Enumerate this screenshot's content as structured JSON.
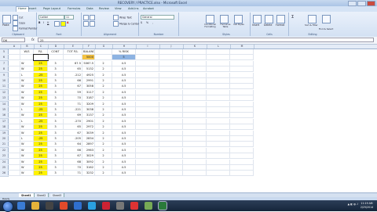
{
  "window": {
    "title": "RECOVERY / PRACTICE.xlsx - Microsoft Excel"
  },
  "ribbon_tabs": [
    "Home",
    "Insert",
    "Page Layout",
    "Formulas",
    "Data",
    "Review",
    "View",
    "Add-Ins",
    "Acrobat"
  ],
  "ribbon": {
    "clipboard": {
      "label": "Clipboard",
      "paste": "Paste",
      "cut": "Cut",
      "copy": "Copy",
      "format_painter": "Format Painter"
    },
    "font": {
      "label": "Font",
      "font_name": "Calibri",
      "font_size": "11"
    },
    "alignment": {
      "label": "Alignment",
      "wrap_text": "Wrap Text",
      "merge": "Merge & Center"
    },
    "number": {
      "label": "Number",
      "format": "General"
    },
    "styles": {
      "label": "Styles",
      "conditional": "Conditional Formatting",
      "format_table": "Format as Table",
      "cell_styles": "Cell Styles"
    },
    "cells": {
      "label": "Cells",
      "insert": "Insert",
      "delete": "Delete",
      "format": "Format"
    },
    "editing": {
      "label": "Editing",
      "sort": "Sort & Filter",
      "find": "Find & Select"
    }
  },
  "formula_bar": {
    "name_box": "D6",
    "fx": "fx",
    "value": "25"
  },
  "columns": [
    "A",
    "B",
    "C",
    "D",
    "E",
    "F",
    "G",
    "H",
    "I",
    "J",
    "K",
    "L",
    "M"
  ],
  "header_row": {
    "row_num": "5",
    "cells": [
      "",
      "W/S",
      "P/L",
      "CONT",
      "TOT P/L",
      "BALANCE",
      "",
      "% RISK"
    ]
  },
  "rows": [
    {
      "n": "6",
      "ws": "",
      "pl": "",
      "cont": "",
      "tot": "",
      "bal": "5000",
      "r": "",
      "risk": "5"
    },
    {
      "n": "7",
      "ws": "W",
      "pl": "25",
      "cont": "3",
      "tot": "67.5",
      "bal": "5067.5",
      "r": "2",
      "risk": "4.5"
    },
    {
      "n": "8",
      "ws": "W",
      "pl": "25",
      "cont": "3",
      "tot": "65",
      "bal": "5132",
      "r": "2",
      "risk": "4.5"
    },
    {
      "n": "9",
      "ws": "L",
      "pl": "-25",
      "cont": "3",
      "tot": "-212",
      "bal": "4925",
      "r": "2",
      "risk": "4.5"
    },
    {
      "n": "10",
      "ws": "W",
      "pl": "25",
      "cont": "3",
      "tot": "66",
      "bal": "2991",
      "r": "2",
      "risk": "4.5"
    },
    {
      "n": "11",
      "ws": "W",
      "pl": "25",
      "cont": "3",
      "tot": "67",
      "bal": "3058",
      "r": "2",
      "risk": "4.5"
    },
    {
      "n": "12",
      "ws": "W",
      "pl": "25",
      "cont": "3",
      "tot": "59",
      "bal": "3117",
      "r": "2",
      "risk": "4.5"
    },
    {
      "n": "13",
      "ws": "W",
      "pl": "25",
      "cont": "3",
      "tot": "70",
      "bal": "3187",
      "r": "2",
      "risk": "4.5"
    },
    {
      "n": "14",
      "ws": "W",
      "pl": "25",
      "cont": "3",
      "tot": "71",
      "bal": "3209",
      "r": "2",
      "risk": "4.5"
    },
    {
      "n": "15",
      "ws": "L",
      "pl": "-25",
      "cont": "3",
      "tot": "-221",
      "bal": "3038",
      "r": "2",
      "risk": "4.5"
    },
    {
      "n": "16",
      "ws": "W",
      "pl": "25",
      "cont": "3",
      "tot": "69",
      "bal": "3137",
      "r": "2",
      "risk": "4.5"
    },
    {
      "n": "17",
      "ws": "L",
      "pl": "-25",
      "cont": "3",
      "tot": "-270",
      "bal": "2901",
      "r": "2",
      "risk": "4.5"
    },
    {
      "n": "18",
      "ws": "W",
      "pl": "25",
      "cont": "3",
      "tot": "65",
      "bal": "2972",
      "r": "2",
      "risk": "4.5"
    },
    {
      "n": "19",
      "ws": "W",
      "pl": "25",
      "cont": "3",
      "tot": "67",
      "bal": "3039",
      "r": "2",
      "risk": "4.5"
    },
    {
      "n": "20",
      "ws": "L",
      "pl": "-25",
      "cont": "3",
      "tot": "-205",
      "bal": "2834",
      "r": "2",
      "risk": "4.5"
    },
    {
      "n": "21",
      "ws": "W",
      "pl": "25",
      "cont": "3",
      "tot": "64",
      "bal": "2897",
      "r": "2",
      "risk": "4.5"
    },
    {
      "n": "22",
      "ws": "W",
      "pl": "25",
      "cont": "3",
      "tot": "66",
      "bal": "2963",
      "r": "2",
      "risk": "4.5"
    },
    {
      "n": "23",
      "ws": "W",
      "pl": "25",
      "cont": "3",
      "tot": "67",
      "bal": "3029",
      "r": "2",
      "risk": "4.5"
    },
    {
      "n": "24",
      "ws": "W",
      "pl": "25",
      "cont": "3",
      "tot": "68",
      "bal": "3092",
      "r": "2",
      "risk": "4.5"
    },
    {
      "n": "25",
      "ws": "W",
      "pl": "25",
      "cont": "3",
      "tot": "70",
      "bal": "3162",
      "r": "2",
      "risk": "4.5"
    },
    {
      "n": "26",
      "ws": "W",
      "pl": "25",
      "cont": "3",
      "tot": "71",
      "bal": "3232",
      "r": "2",
      "risk": "4.5"
    }
  ],
  "sheet_tabs": [
    "Sheet1",
    "Sheet2",
    "Sheet3"
  ],
  "status": {
    "text": "Ready"
  },
  "clock": {
    "time": "11:19 AM",
    "date": "2/25/2014"
  },
  "colors": {
    "highlight_yellow": "#fff200",
    "highlight_orange": "#f5c342",
    "highlight_blue": "#8db3e2",
    "ribbon_bg": "#d3e1f3",
    "taskbar": "#1c2c44"
  }
}
